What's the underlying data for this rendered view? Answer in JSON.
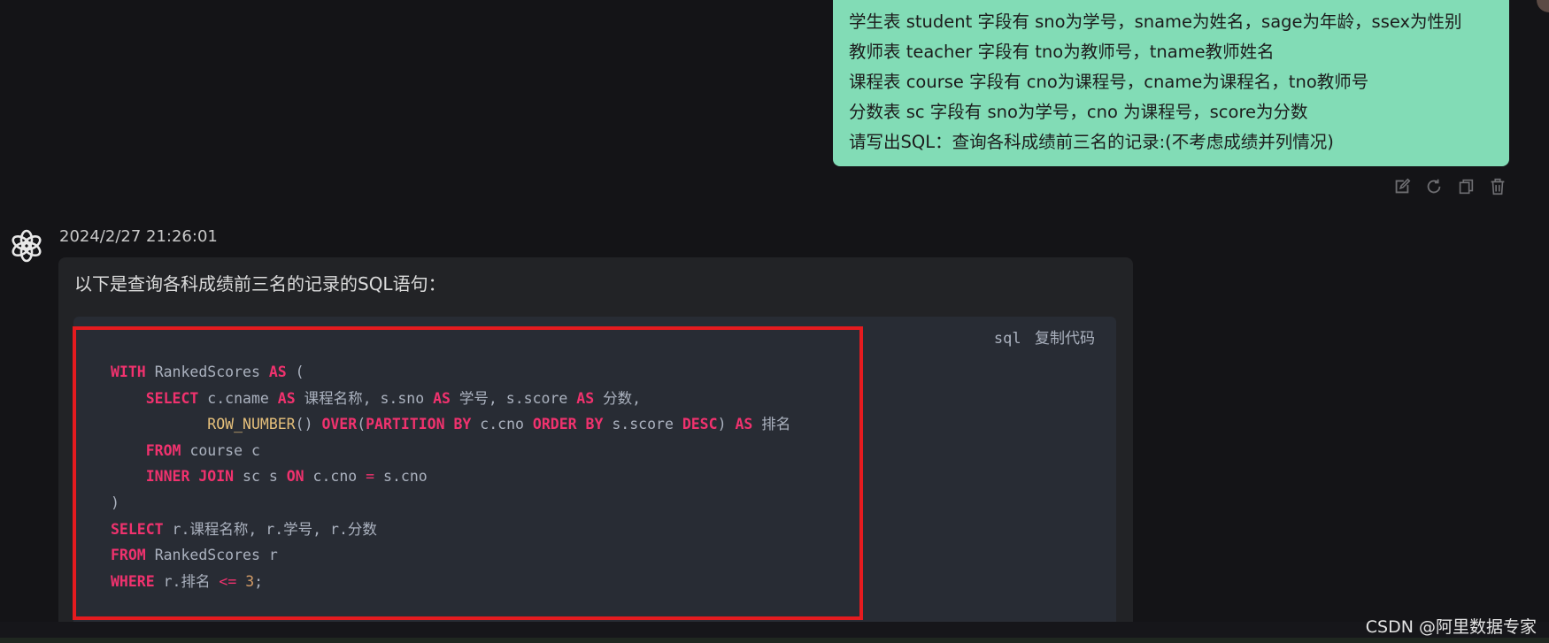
{
  "user_message": {
    "lines": [
      "学生表 student 字段有 sno为学号，sname为姓名，sage为年龄，ssex为性别",
      "教师表 teacher 字段有 tno为教师号，tname教师姓名",
      "课程表 course 字段有 cno为课程号，cname为课程名，tno教师号",
      "分数表 sc 字段有 sno为学号，cno 为课程号，score为分数",
      "请写出SQL：查询各科成绩前三名的记录:(不考虑成绩并列情况)"
    ],
    "actions": [
      "edit-icon",
      "refresh-icon",
      "copy-icon",
      "delete-icon"
    ]
  },
  "assistant_message": {
    "timestamp": "2024/2/27 21:26:01",
    "intro": "以下是查询各科成绩前三名的记录的SQL语句：",
    "code": {
      "language": "sql",
      "copy_label": "复制代码",
      "lines": [
        "WITH RankedScores AS (",
        "    SELECT c.cname AS 课程名称, s.sno AS 学号, s.score AS 分数,",
        "           ROW_NUMBER() OVER(PARTITION BY c.cno ORDER BY s.score DESC) AS 排名",
        "    FROM course c",
        "    INNER JOIN sc s ON c.cno = s.cno",
        ")",
        "SELECT r.课程名称, r.学号, r.分数",
        "FROM RankedScores r",
        "WHERE r.排名 <= 3;"
      ]
    }
  },
  "watermark": "CSDN @阿里数据专家",
  "colors": {
    "background": "#141417",
    "user_bubble": "#82dcb6",
    "code_background": "#282c34",
    "keyword": "#f0326e",
    "function": "#e6c07b",
    "number": "#d19a66",
    "highlight_border": "#e51b1f"
  }
}
